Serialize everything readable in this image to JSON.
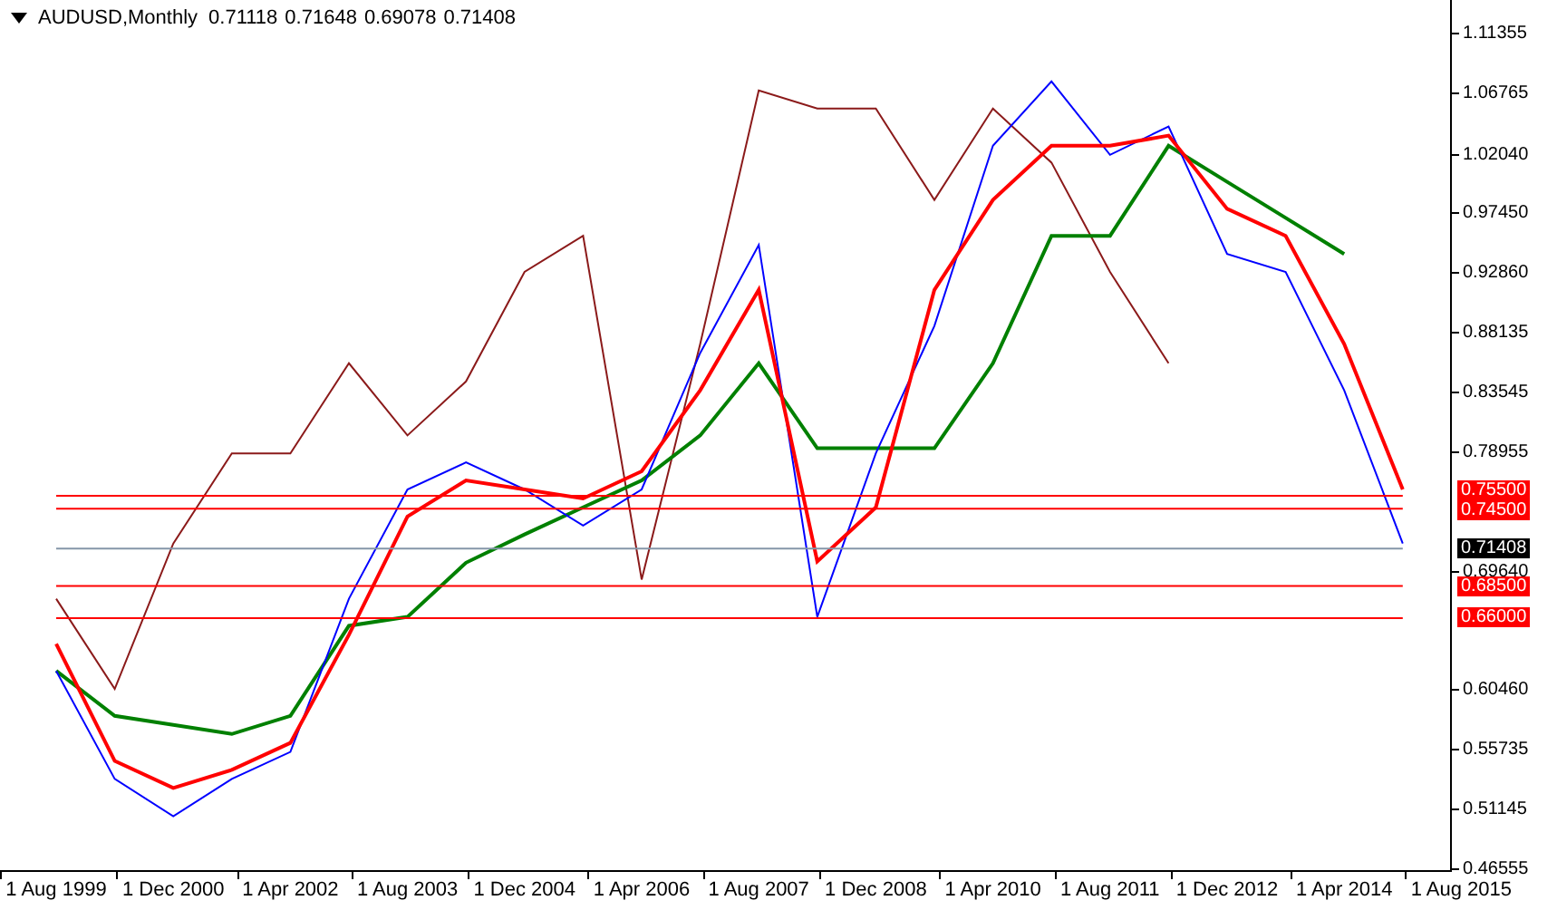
{
  "header": {
    "symbol": "AUDUSD,Monthly",
    "values": [
      "0.71118",
      "0.71648",
      "0.69078",
      "0.71408"
    ]
  },
  "chart": {
    "chart_data": {
      "type": "line",
      "categories": [
        "1 Aug 1999",
        null,
        "1 Dec 2000",
        null,
        "1 Apr 2002",
        null,
        "1 Aug 2003",
        null,
        "1 Dec 2004",
        null,
        "1 Apr 2006",
        null,
        "1 Aug 2007",
        null,
        "1 Dec 2008",
        null,
        "1 Apr 2010",
        null,
        "1 Aug 2011",
        null,
        "1 Dec 2012",
        null,
        "1 Apr 2014",
        null,
        "1 Aug 2015"
      ],
      "series": [
        {
          "color": "#8b1a1a",
          "values": [
            0.675,
            0.605,
            0.718,
            0.788,
            0.788,
            0.858,
            0.802,
            0.844,
            0.929,
            0.957,
            0.69,
            0.873,
            1.07,
            1.056,
            1.056,
            0.985,
            1.056,
            1.014,
            0.929,
            0.858,
            null,
            null,
            null,
            null,
            null
          ]
        },
        {
          "color": "#008000",
          "values": [
            0.619,
            0.584,
            0.577,
            0.57,
            0.584,
            0.654,
            0.661,
            0.703,
            0.725,
            0.746,
            0.767,
            0.802,
            0.858,
            0.792,
            0.792,
            0.792,
            0.858,
            0.957,
            0.957,
            1.027,
            0.999,
            0.971,
            0.943,
            null,
            null
          ]
        },
        {
          "color": "#0000ff",
          "values": [
            0.619,
            0.535,
            0.506,
            0.535,
            0.556,
            0.675,
            0.76,
            0.781,
            0.76,
            0.732,
            0.76,
            0.866,
            0.95,
            0.661,
            0.788,
            0.887,
            1.027,
            1.077,
            1.02,
            1.042,
            0.943,
            0.929,
            0.837,
            0.718,
            null
          ]
        },
        {
          "color": "#ff0000",
          "values": [
            0.64,
            0.549,
            0.528,
            0.542,
            0.563,
            0.647,
            0.739,
            0.767,
            0.76,
            0.753,
            0.774,
            0.837,
            0.915,
            0.704,
            0.746,
            0.915,
            0.985,
            1.027,
            1.027,
            1.035,
            0.978,
            0.957,
            0.873,
            0.76,
            null
          ]
        },
        {
          "color": "#ff0000",
          "values": [
            0.755,
            0.755,
            0.755,
            0.755,
            0.755,
            0.755,
            0.755,
            0.755,
            0.755,
            0.755,
            0.755,
            0.755,
            0.755,
            0.755,
            0.755,
            0.755,
            0.755,
            0.755,
            0.755,
            0.755,
            0.755,
            0.755,
            0.755,
            0.755,
            null
          ]
        },
        {
          "color": "#ff0000",
          "values": [
            0.745,
            0.745,
            0.745,
            0.745,
            0.745,
            0.745,
            0.745,
            0.745,
            0.745,
            0.745,
            0.745,
            0.745,
            0.745,
            0.745,
            0.745,
            0.745,
            0.745,
            0.745,
            0.745,
            0.745,
            0.745,
            0.745,
            0.745,
            0.745,
            null
          ]
        },
        {
          "color": "#8496a8",
          "values": [
            0.714,
            0.714,
            0.714,
            0.714,
            0.714,
            0.714,
            0.714,
            0.714,
            0.714,
            0.714,
            0.714,
            0.714,
            0.714,
            0.714,
            0.714,
            0.714,
            0.714,
            0.714,
            0.714,
            0.714,
            0.714,
            0.714,
            0.714,
            0.714,
            null
          ]
        },
        {
          "color": "#ff0000",
          "values": [
            0.685,
            0.685,
            0.685,
            0.685,
            0.685,
            0.685,
            0.685,
            0.685,
            0.685,
            0.685,
            0.685,
            0.685,
            0.685,
            0.685,
            0.685,
            0.685,
            0.685,
            0.685,
            0.685,
            0.685,
            0.685,
            0.685,
            0.685,
            0.685,
            null
          ]
        },
        {
          "color": "#ff0000",
          "values": [
            0.66,
            0.66,
            0.66,
            0.66,
            0.66,
            0.66,
            0.66,
            0.66,
            0.66,
            0.66,
            0.66,
            0.66,
            0.66,
            0.66,
            0.66,
            0.66,
            0.66,
            0.66,
            0.66,
            0.66,
            0.66,
            0.66,
            0.66,
            0.66,
            null
          ]
        }
      ],
      "ylim": [
        0.46416,
        1.14031
      ],
      "yticks": [
        {
          "value": 1.11355,
          "label": "1.11355"
        },
        {
          "value": 1.06765,
          "label": "1.06765"
        },
        {
          "value": 1.0204,
          "label": "1.02040"
        },
        {
          "value": 0.9745,
          "label": "0.97450"
        },
        {
          "value": 0.9286,
          "label": "0.92860"
        },
        {
          "value": 0.88135,
          "label": "0.88135"
        },
        {
          "value": 0.83545,
          "label": "0.83545"
        },
        {
          "value": 0.78955,
          "label": "0.78955"
        },
        {
          "value": 0.6964,
          "label": "0.69640"
        },
        {
          "value": 0.6046,
          "label": "0.60460"
        },
        {
          "value": 0.55735,
          "label": "0.55735"
        },
        {
          "value": 0.51145,
          "label": "0.51145"
        },
        {
          "value": 0.46555,
          "label": "0.46555"
        }
      ]
    },
    "price_labels": [
      {
        "label": "0.75500",
        "color": "#ff0000"
      },
      {
        "label": "0.74500",
        "color": "#ff0000"
      },
      {
        "label": "0.71408",
        "color": "#000000"
      },
      {
        "label": "0.68500",
        "color": "#ff0000"
      },
      {
        "label": "0.66000",
        "color": "#ff0000"
      }
    ]
  }
}
